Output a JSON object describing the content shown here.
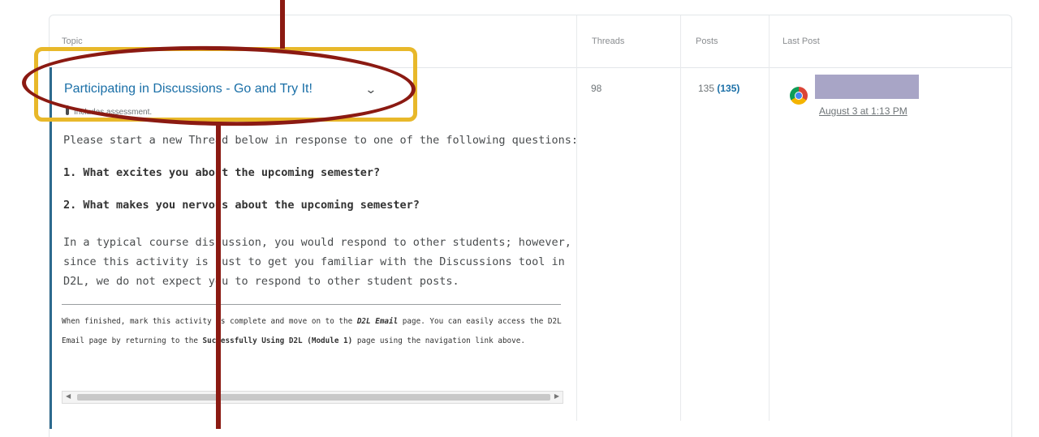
{
  "table": {
    "headers": {
      "topic": "Topic",
      "threads": "Threads",
      "posts": "Posts",
      "last_post": "Last Post"
    }
  },
  "row": {
    "title": "Participating in Discussions - Go and Try It!",
    "assessment_note": "Includes assessment.",
    "intro": "Please start a new Thread below in response to one of the following questions:",
    "question_1": "1. What excites you about the upcoming semester?",
    "question_2": "2. What makes you nervous about the upcoming semester?",
    "paragraph": "In a typical course discussion, you would respond to other students; however, since this activity is just to get you familiar with the Discussions tool in D2L, we do not expect you to respond to other student posts.",
    "finish_1": "When finished, mark this activity as complete and move on to the ",
    "finish_link_1": "D2L Email",
    "finish_2": " page. You can easily access the D2L Email page by returning to the ",
    "finish_link_2": "Successfully Using D2L (Module 1)",
    "finish_3": "  page using the navigation link above.",
    "threads": "98",
    "posts": "135",
    "posts_unread": "(135)",
    "last_post_date": "August 3 at 1:13 PM"
  },
  "icons": {
    "chevron": "chevron-down-icon",
    "assessment": "assessment-icon",
    "avatar": "browser-avatar-icon"
  },
  "colors": {
    "link": "#1a6fa7",
    "highlight_box": "#e8b82a",
    "highlight_oval": "#8b1a12",
    "left_bar": "#2d6a8e"
  }
}
